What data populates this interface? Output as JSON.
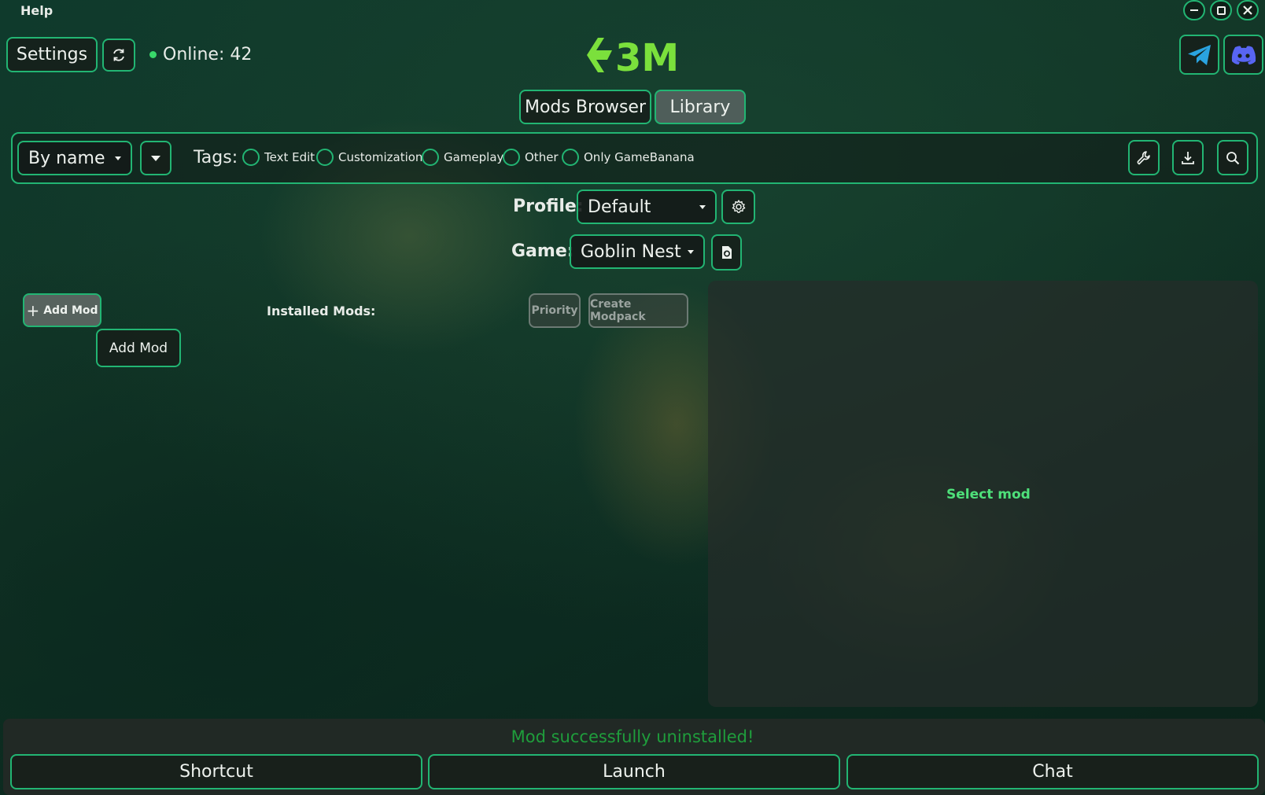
{
  "menu": {
    "help": "Help"
  },
  "window_controls": {
    "minimize": "–",
    "maximize": "□",
    "close": "✕"
  },
  "header": {
    "settings_label": "Settings",
    "online_text": "Online: 42",
    "logo_text": "3M"
  },
  "tabs": [
    {
      "label": "Mods Browser",
      "active": false
    },
    {
      "label": "Library",
      "active": true
    }
  ],
  "filters": {
    "sort_value": "By name",
    "tags_label": "Tags:",
    "tags": [
      "Text Edit",
      "Customization",
      "Gameplay",
      "Other",
      "Only GameBanana"
    ]
  },
  "profile": {
    "label": "Profile:",
    "value": "Default"
  },
  "game": {
    "label": "Game:",
    "value": "Goblin Nest"
  },
  "mods": {
    "add_mod_label": "Add Mod",
    "add_mod_tooltip": "Add Mod",
    "installed_label": "Installed Mods:",
    "priority_label": "Priority",
    "create_modpack_label": "Create Modpack"
  },
  "details": {
    "placeholder": "Select mod"
  },
  "status": {
    "message": "Mod successfully uninstalled!"
  },
  "bottom": {
    "shortcut_label": "Shortcut",
    "launch_label": "Launch",
    "chat_label": "Chat"
  },
  "colors": {
    "accent": "#22b573",
    "status_success": "#1f9e3c",
    "select_mod": "#4ee07a",
    "telegram": "#2aa3e0",
    "discord": "#5865f2"
  }
}
